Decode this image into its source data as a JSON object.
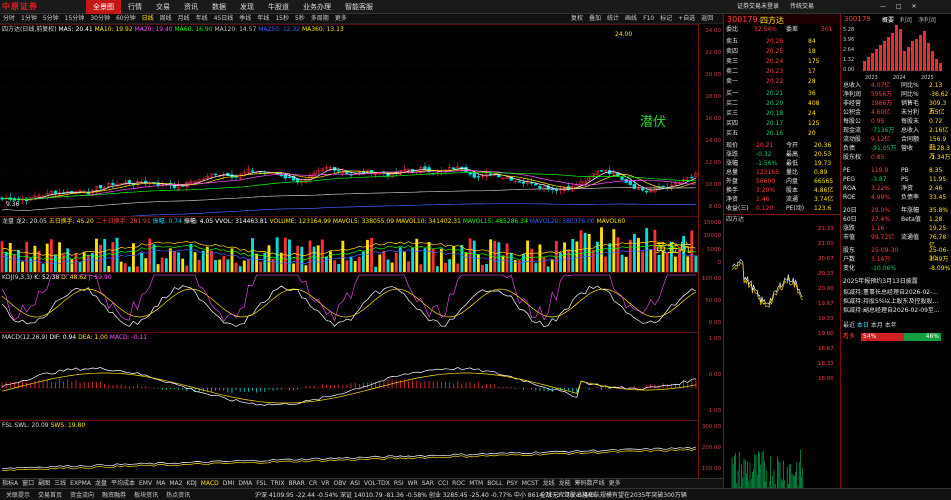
{
  "app": {
    "logo": "中原证券",
    "menu": [
      "全景图",
      "行情",
      "交易",
      "资讯",
      "数据",
      "发现",
      "牛股道",
      "业务办理",
      "智能客服"
    ],
    "active_menu": "全景图",
    "top_right": [
      "证券交易未登录",
      "传统交易"
    ]
  },
  "periods": [
    "分时",
    "1分钟",
    "5分钟",
    "15分钟",
    "30分钟",
    "60分钟",
    "日线",
    "周线",
    "月线",
    "年线",
    "45日线",
    "季线",
    "年线",
    "15秒",
    "5秒",
    "多周期",
    "更多"
  ],
  "selected_period": "日线",
  "tools": [
    "复权",
    "叠加",
    "统计",
    "画线",
    "F10",
    "标记",
    "+自选",
    "返回"
  ],
  "stock": {
    "code": "300179",
    "name": "四方达"
  },
  "main": {
    "title": "四方达(日线,前复权)",
    "ma": [
      {
        "t": "MA5: 20.41",
        "c": "#ffffff"
      },
      {
        "t": "MA10: 19.92",
        "c": "#ffe000"
      },
      {
        "t": "MA20: 19.40",
        "c": "#ff50ff"
      },
      {
        "t": "MA60: 16.90",
        "c": "#00ff00"
      },
      {
        "t": "MA120: 14.57",
        "c": "#c0c0c0"
      },
      {
        "t": "MA250: 12.32",
        "c": "#4060ff"
      },
      {
        "t": "MA360: 13.13",
        "c": "#ffe000"
      }
    ],
    "axis": [
      "24.00",
      "22.00",
      "20.00",
      "18.00",
      "16.00",
      "14.00",
      "12.00",
      "10.00",
      "8.00"
    ],
    "high": "24.00",
    "low": "9.36",
    "label": "潜伏"
  },
  "vol": {
    "title": "龙盘 龙2: 20.05",
    "items": [
      {
        "t": "五日换手: 45.20",
        "c": "#ffe000"
      },
      {
        "t": "二十日换手: 281.91",
        "c": "#ff3c3c"
      },
      {
        "t": "振幅: 0.74",
        "c": "#00d0ff"
      },
      {
        "t": "振幅: 4.05",
        "c": "#ffffff"
      },
      {
        "t": "VVOL: 314463.81",
        "c": "#ffffff"
      },
      {
        "t": "VOLUME: 123164.99",
        "c": "#ffe000"
      },
      {
        "t": "MAVOL5: 338055.09",
        "c": "#ffe000"
      },
      {
        "t": "MAVOL10: 341402.31",
        "c": "#ffe000"
      },
      {
        "t": "MAVOL15: 485286.34",
        "c": "#00ff00"
      },
      {
        "t": "MAVOL20: 380376.00",
        "c": "#4060ff"
      },
      {
        "t": "MAVOL60",
        "c": "#ffe000"
      }
    ],
    "axis": [
      "15000",
      "10000",
      "5000",
      "0"
    ],
    "label": "黄金坑"
  },
  "kdj": {
    "title": "KDJ(9,3,3)",
    "items": [
      {
        "t": "K: 52.38",
        "c": "#ffffff"
      },
      {
        "t": "D: 48.62",
        "c": "#ffe000"
      },
      {
        "t": "J: 59.90",
        "c": "#ff50ff"
      }
    ],
    "axis": [
      "100.00",
      "50.00",
      "0.00"
    ]
  },
  "macd": {
    "title": "MACD(12,26,9)",
    "items": [
      {
        "t": "DIF: 0.94",
        "c": "#ffffff"
      },
      {
        "t": "DEA: 1.00",
        "c": "#ffe000"
      },
      {
        "t": "MACD: -0.11",
        "c": "#ff50ff"
      }
    ],
    "axis": [
      "1.00",
      "0.00",
      "-1.00"
    ]
  },
  "fsl": {
    "title": "FSL SWL: 20.09",
    "items": [
      {
        "t": "SWS: 19.80",
        "c": "#ffe000"
      }
    ],
    "axis": [
      "300.00",
      "200.00",
      "100.00"
    ]
  },
  "indicators": [
    "指标A",
    "窗口",
    "副图",
    "三线",
    "EXPMA",
    "龙盘",
    "平均成本",
    "EMV",
    "MA",
    "MA2",
    "KDJ",
    "MACD",
    "DMI",
    "DMA",
    "FSL",
    "TRIX",
    "BRAR",
    "CR",
    "VR",
    "OBV",
    "ASI",
    "VOL-TDX",
    "RSI",
    "WR",
    "SAR",
    "CCI",
    "ROC",
    "MTM",
    "BOLL",
    "PSY",
    "MCST",
    "龙线",
    "龙能",
    "筹码数产线",
    "更多"
  ],
  "orderbook": {
    "code": "300179",
    "name": "四方达",
    "weibi": "32.54%",
    "weicha": "301",
    "sells": [
      [
        "卖五",
        "20.26",
        "84"
      ],
      [
        "卖四",
        "20.25",
        "18"
      ],
      [
        "卖三",
        "20.24",
        "175"
      ],
      [
        "卖二",
        "20.23",
        "17"
      ],
      [
        "卖一",
        "20.22",
        "28"
      ]
    ],
    "buys": [
      [
        "买一",
        "20.21",
        "36"
      ],
      [
        "买二",
        "20.20",
        "408"
      ],
      [
        "买三",
        "20.18",
        "24"
      ],
      [
        "买四",
        "20.17",
        "125"
      ],
      [
        "买五",
        "20.16",
        "20"
      ]
    ]
  },
  "quote": [
    [
      "现价",
      "20.21",
      "今开",
      "20.36"
    ],
    [
      "涨跌",
      "-0.32",
      "最高",
      "20.53"
    ],
    [
      "涨幅",
      "-1.56%",
      "最低",
      "19.73"
    ],
    [
      "总量",
      "123165",
      "量比",
      "0.89"
    ],
    [
      "外盘",
      "56600",
      "内盘",
      "66565"
    ],
    [
      "换手",
      "3.29%",
      "股本",
      "4.86亿"
    ],
    [
      "净资",
      "2.46",
      "流通",
      "3.74亿"
    ],
    [
      "收益(三)",
      "0.120",
      "PE(动)",
      "123.6"
    ]
  ],
  "fin": {
    "code": "300179",
    "tabs": [
      "概要",
      "利润",
      "净利润"
    ],
    "y": [
      "5.28",
      "3.96",
      "2.64",
      "1.32",
      "0.00"
    ],
    "years": [
      "2023",
      "2024",
      "2025"
    ],
    "rows": [
      [
        "总收入",
        "4.07亿",
        "同比%",
        "2.13"
      ],
      [
        "净利润",
        "5956万",
        "同比%",
        "-36.62"
      ],
      [
        "非经营",
        "1986万",
        "销售毛",
        "309.3万"
      ],
      [
        "公积金",
        "4.60亿",
        "未分利",
        "3.5亿"
      ],
      [
        "每股公",
        "0.95",
        "每股未",
        "0.72"
      ],
      [
        "现金流",
        "-7136万",
        "总收入",
        "2.16亿"
      ],
      [
        "流动股",
        "9.12亿",
        "合同额",
        "156.9万"
      ],
      [
        "负债",
        "-91.05万",
        "营收",
        "5128.3万"
      ],
      [
        "股东权",
        "0.85",
        "",
        "-1.34万"
      ]
    ],
    "val": [
      [
        "PE",
        "119.9",
        "PB",
        "8.35"
      ],
      [
        "PEG",
        "-3.87",
        "PS",
        "11.95"
      ],
      [
        "ROA",
        "3.22%",
        "净资",
        "2.46"
      ],
      [
        "ROE",
        "4.99%",
        "负债率",
        "33.45"
      ]
    ],
    "rank": [
      [
        "20日",
        "29.0%",
        "年涨幅",
        "35.8%"
      ],
      [
        "60日",
        "27.4%",
        "Beta值",
        "1.28"
      ],
      [
        "涨跌",
        "1.16",
        "",
        "19.25"
      ],
      [
        "市值",
        "99.72亿",
        "流通值",
        "76.78亿"
      ]
    ],
    "holder": [
      [
        "股东",
        "25-09-30",
        "",
        "25-06-30"
      ],
      [
        "户数",
        "3.14万",
        "",
        "3.49万"
      ],
      [
        "变化",
        "-10.06%",
        "",
        "-8.09%"
      ]
    ],
    "news": "2025年报预约3月13日披露",
    "news2": [
      "拟减持:董事长总经理自2026-02-...",
      "拟减持:持股5%以上股东及控股股...",
      "拟减持:副总经理自2026-02-09至..."
    ]
  },
  "today": {
    "axis": [
      "21.33",
      "21.00",
      "20.67",
      "20.33",
      "20.00",
      "19.67",
      "19.33",
      "19.00",
      "18.67",
      "18.33",
      "18.00"
    ],
    "tabs": [
      "最近",
      "本日",
      "本月",
      "本年"
    ],
    "bull": "54%",
    "bear": "46%",
    "bull_label": "看多",
    "bear_label": "看空"
  },
  "bottom": {
    "left": [
      "关联提示",
      "交易首页",
      "资金流向",
      "融资融券",
      "板块资讯",
      "热点资讯"
    ],
    "ticker": "沪深 4109.95 -22.44 -0.54%   深证 14010.79 -81.36 -0.58%   创业 3285.45 -25.40 -0.77%   中小 8614.71 -37.70 -0.44%",
    "news": "全球无人驾驶出租车队规模有望在2035年突破300万辆"
  }
}
